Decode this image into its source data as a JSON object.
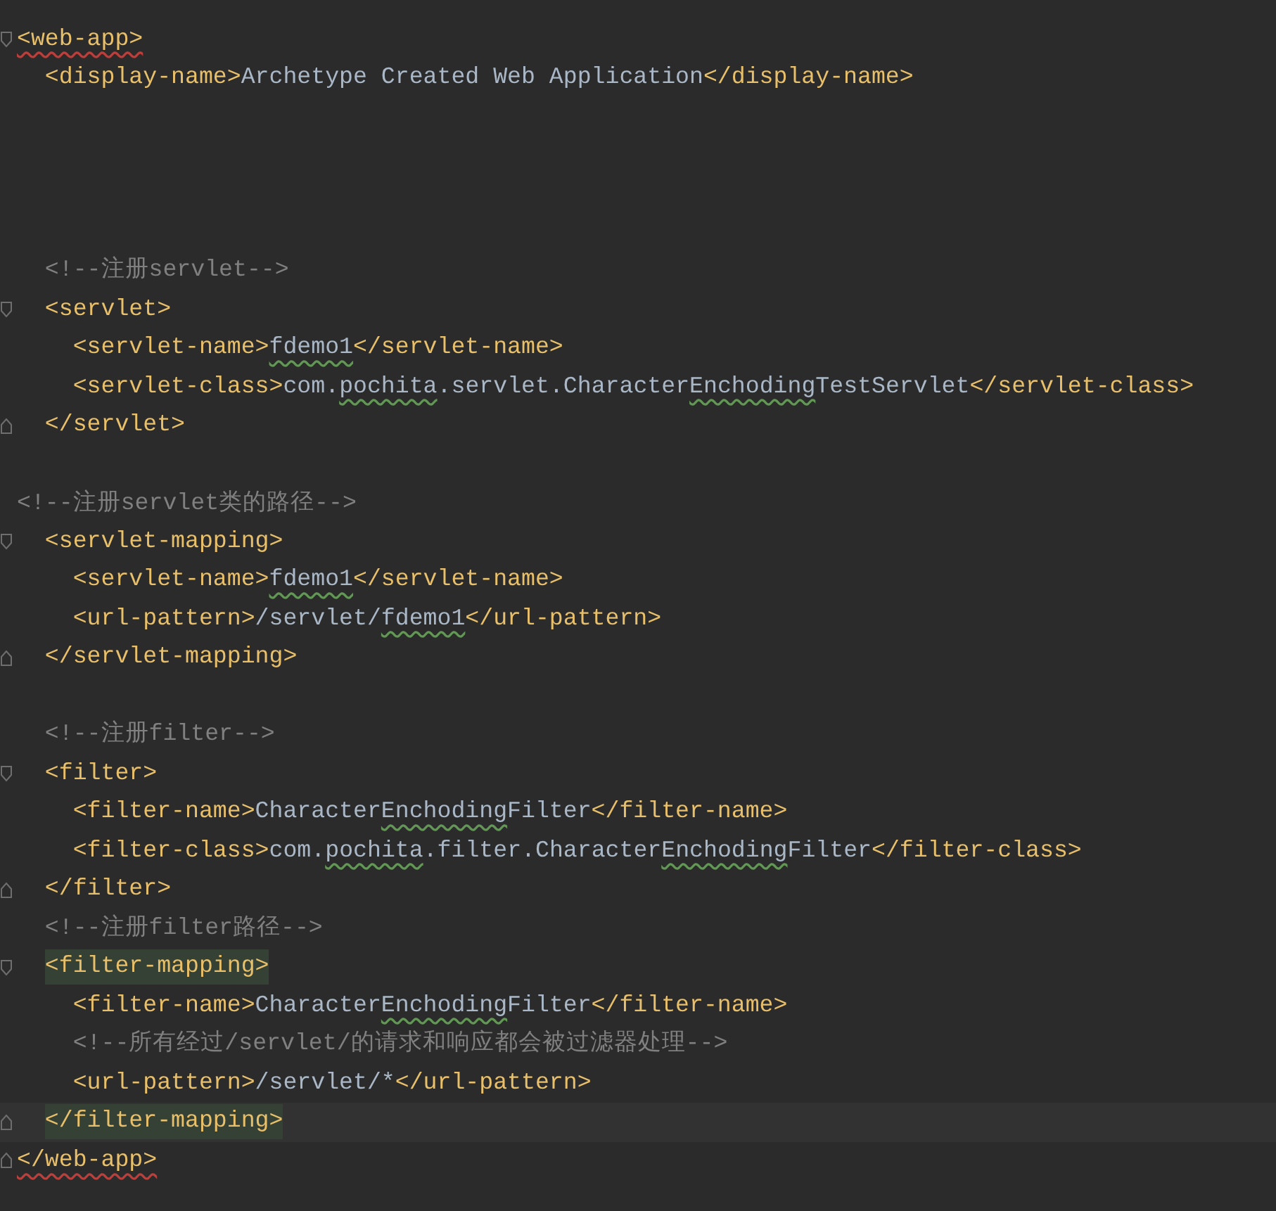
{
  "editor": {
    "lines": [
      {
        "kind": "code",
        "fold_start": true,
        "tokens": [
          {
            "kind": "tag",
            "text": "<web-app>",
            "error": true
          }
        ]
      },
      {
        "kind": "code",
        "tokens": [
          {
            "kind": "tag",
            "text": "  <display-name>"
          },
          {
            "kind": "value",
            "text": "Archetype Created Web Application"
          },
          {
            "kind": "tag",
            "text": "</display-name>"
          }
        ]
      },
      {
        "kind": "blank"
      },
      {
        "kind": "blank"
      },
      {
        "kind": "blank"
      },
      {
        "kind": "blank"
      },
      {
        "kind": "code",
        "tokens": [
          {
            "kind": "comment",
            "text": "  <!--注册servlet-->"
          }
        ]
      },
      {
        "kind": "code",
        "fold_start": true,
        "tokens": [
          {
            "kind": "tag",
            "text": "  <servlet>"
          }
        ]
      },
      {
        "kind": "code",
        "tokens": [
          {
            "kind": "tag",
            "text": "    <servlet-name>"
          },
          {
            "kind": "value",
            "text": "fdemo1",
            "warning": true
          },
          {
            "kind": "tag",
            "text": "</servlet-name>"
          }
        ]
      },
      {
        "kind": "code",
        "tokens": [
          {
            "kind": "tag",
            "text": "    <servlet-class>"
          },
          {
            "kind": "value",
            "text": "com."
          },
          {
            "kind": "value",
            "text": "pochita",
            "warning": true
          },
          {
            "kind": "value",
            "text": ".servlet.Character"
          },
          {
            "kind": "value",
            "text": "Enchoding",
            "warning": true
          },
          {
            "kind": "value",
            "text": "TestServlet"
          },
          {
            "kind": "tag",
            "text": "</servlet-class>"
          }
        ]
      },
      {
        "kind": "code",
        "fold_end": true,
        "tokens": [
          {
            "kind": "tag",
            "text": "  </servlet>"
          }
        ]
      },
      {
        "kind": "blank"
      },
      {
        "kind": "code",
        "tokens": [
          {
            "kind": "comment",
            "text": "<!--注册servlet类的路径-->"
          }
        ]
      },
      {
        "kind": "code",
        "fold_start": true,
        "tokens": [
          {
            "kind": "tag",
            "text": "  <servlet-mapping>"
          }
        ]
      },
      {
        "kind": "code",
        "tokens": [
          {
            "kind": "tag",
            "text": "    <servlet-name>"
          },
          {
            "kind": "value",
            "text": "fdemo1",
            "warning": true
          },
          {
            "kind": "tag",
            "text": "</servlet-name>"
          }
        ]
      },
      {
        "kind": "code",
        "tokens": [
          {
            "kind": "tag",
            "text": "    <url-pattern>"
          },
          {
            "kind": "value",
            "text": "/servlet/"
          },
          {
            "kind": "value",
            "text": "fdemo1",
            "warning": true
          },
          {
            "kind": "tag",
            "text": "</url-pattern>"
          }
        ]
      },
      {
        "kind": "code",
        "fold_end": true,
        "tokens": [
          {
            "kind": "tag",
            "text": "  </servlet-mapping>"
          }
        ]
      },
      {
        "kind": "blank"
      },
      {
        "kind": "code",
        "tokens": [
          {
            "kind": "comment",
            "text": "  <!--注册filter-->"
          }
        ]
      },
      {
        "kind": "code",
        "fold_start": true,
        "tokens": [
          {
            "kind": "tag",
            "text": "  <filter>"
          }
        ]
      },
      {
        "kind": "code",
        "tokens": [
          {
            "kind": "tag",
            "text": "    <filter-name>"
          },
          {
            "kind": "value",
            "text": "Character"
          },
          {
            "kind": "value",
            "text": "Enchoding",
            "warning": true
          },
          {
            "kind": "value",
            "text": "Filter"
          },
          {
            "kind": "tag",
            "text": "</filter-name>"
          }
        ]
      },
      {
        "kind": "code",
        "tokens": [
          {
            "kind": "tag",
            "text": "    <filter-class>"
          },
          {
            "kind": "value",
            "text": "com."
          },
          {
            "kind": "value",
            "text": "pochita",
            "warning": true
          },
          {
            "kind": "value",
            "text": ".filter.Character"
          },
          {
            "kind": "value",
            "text": "Enchoding",
            "warning": true
          },
          {
            "kind": "value",
            "text": "Filter"
          },
          {
            "kind": "tag",
            "text": "</filter-class>"
          }
        ]
      },
      {
        "kind": "code",
        "fold_end": true,
        "tokens": [
          {
            "kind": "tag",
            "text": "  </filter>"
          }
        ]
      },
      {
        "kind": "code",
        "tokens": [
          {
            "kind": "comment",
            "text": "  <!--注册filter路径-->"
          }
        ]
      },
      {
        "kind": "code",
        "fold_start": true,
        "tokens": [
          {
            "kind": "tag",
            "text": "  <filter-mapping>",
            "highlighted": true
          }
        ]
      },
      {
        "kind": "code",
        "tokens": [
          {
            "kind": "tag",
            "text": "    <filter-name>"
          },
          {
            "kind": "value",
            "text": "Character"
          },
          {
            "kind": "value",
            "text": "Enchoding",
            "warning": true
          },
          {
            "kind": "value",
            "text": "Filter"
          },
          {
            "kind": "tag",
            "text": "</filter-name>"
          }
        ]
      },
      {
        "kind": "code",
        "tokens": [
          {
            "kind": "comment",
            "text": "    <!--所有经过/servlet/的请求和响应都会被过滤器处理-->"
          }
        ]
      },
      {
        "kind": "code",
        "tokens": [
          {
            "kind": "tag",
            "text": "    <url-pattern>"
          },
          {
            "kind": "value",
            "text": "/servlet/*"
          },
          {
            "kind": "tag",
            "text": "</url-pattern>"
          }
        ]
      },
      {
        "kind": "code",
        "fold_end": true,
        "current": true,
        "tokens": [
          {
            "kind": "tag",
            "text": "  </filter-mapping>",
            "highlighted": true
          }
        ]
      },
      {
        "kind": "code",
        "fold_end": true,
        "tokens": [
          {
            "kind": "tag",
            "text": "</web-app>",
            "error": true
          }
        ]
      }
    ]
  }
}
